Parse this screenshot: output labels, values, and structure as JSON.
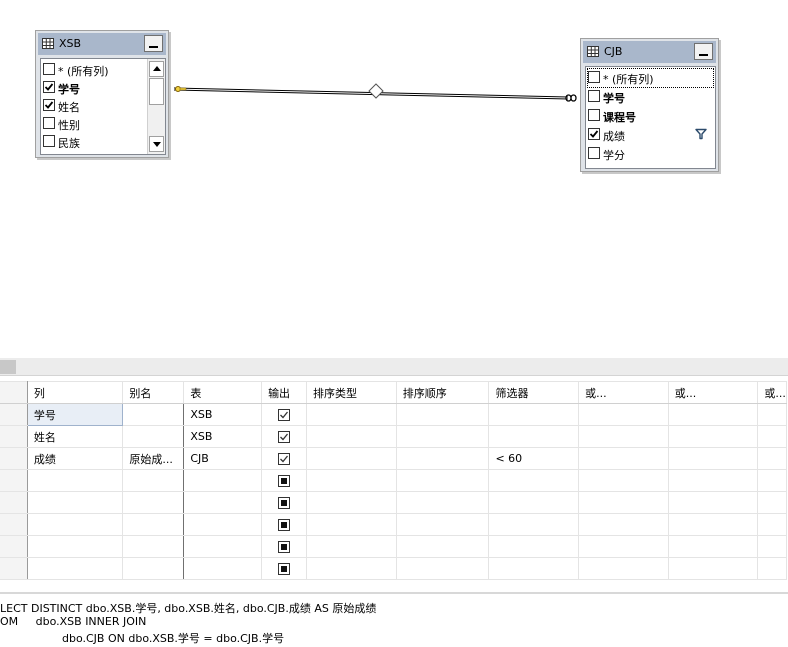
{
  "diagram": {
    "table_xsb": {
      "title": "XSB",
      "columns": [
        {
          "label": "* (所有列)",
          "checked": false,
          "bold": false
        },
        {
          "label": "学号",
          "checked": true,
          "bold": true
        },
        {
          "label": "姓名",
          "checked": true,
          "bold": false
        },
        {
          "label": "性别",
          "checked": false,
          "bold": false
        },
        {
          "label": "民族",
          "checked": false,
          "bold": false
        }
      ]
    },
    "table_cjb": {
      "title": "CJB",
      "columns": [
        {
          "label": "* (所有列)",
          "checked": false,
          "bold": false
        },
        {
          "label": "学号",
          "checked": false,
          "bold": true
        },
        {
          "label": "课程号",
          "checked": false,
          "bold": true
        },
        {
          "label": "成绩",
          "checked": true,
          "bold": false,
          "filter": true
        },
        {
          "label": "学分",
          "checked": false,
          "bold": false
        }
      ]
    }
  },
  "criteria": {
    "headers": [
      "列",
      "别名",
      "表",
      "输出",
      "排序类型",
      "排序顺序",
      "筛选器",
      "或...",
      "或...",
      "或..."
    ],
    "rows": [
      {
        "column": "学号",
        "alias": "",
        "table": "XSB",
        "output": "checked",
        "sort_type": "",
        "sort_order": "",
        "filter": "",
        "or1": "",
        "or2": "",
        "or3": ""
      },
      {
        "column": "姓名",
        "alias": "",
        "table": "XSB",
        "output": "checked",
        "sort_type": "",
        "sort_order": "",
        "filter": "",
        "or1": "",
        "or2": "",
        "or3": ""
      },
      {
        "column": "成绩",
        "alias": "原始成...",
        "table": "CJB",
        "output": "checked",
        "sort_type": "",
        "sort_order": "",
        "filter": "< 60",
        "or1": "",
        "or2": "",
        "or3": ""
      },
      {
        "column": "",
        "alias": "",
        "table": "",
        "output": "indeterminate",
        "sort_type": "",
        "sort_order": "",
        "filter": "",
        "or1": "",
        "or2": "",
        "or3": ""
      },
      {
        "column": "",
        "alias": "",
        "table": "",
        "output": "indeterminate",
        "sort_type": "",
        "sort_order": "",
        "filter": "",
        "or1": "",
        "or2": "",
        "or3": ""
      },
      {
        "column": "",
        "alias": "",
        "table": "",
        "output": "indeterminate",
        "sort_type": "",
        "sort_order": "",
        "filter": "",
        "or1": "",
        "or2": "",
        "or3": ""
      },
      {
        "column": "",
        "alias": "",
        "table": "",
        "output": "indeterminate",
        "sort_type": "",
        "sort_order": "",
        "filter": "",
        "or1": "",
        "or2": "",
        "or3": ""
      },
      {
        "column": "",
        "alias": "",
        "table": "",
        "output": "indeterminate",
        "sort_type": "",
        "sort_order": "",
        "filter": "",
        "or1": "",
        "or2": "",
        "or3": ""
      }
    ]
  },
  "sql": {
    "lines": [
      "LECT DISTINCT dbo.XSB.学号, dbo.XSB.姓名, dbo.CJB.成绩 AS 原始成绩",
      "OM     dbo.XSB INNER JOIN",
      "dbo.CJB ON dbo.XSB.学号 = dbo.CJB.学号"
    ]
  },
  "icons": {
    "table_icon": "grid-icon",
    "minimize": "minimize-icon",
    "filter": "funnel-icon",
    "join_key": "key-icon",
    "join_infinity": "infinity-icon",
    "join_diamond": "diamond-icon"
  },
  "colors": {
    "title_bar": "#a9b7cb",
    "table_frame": "#dfe3e8",
    "selected_cell": "#e8eef6"
  }
}
